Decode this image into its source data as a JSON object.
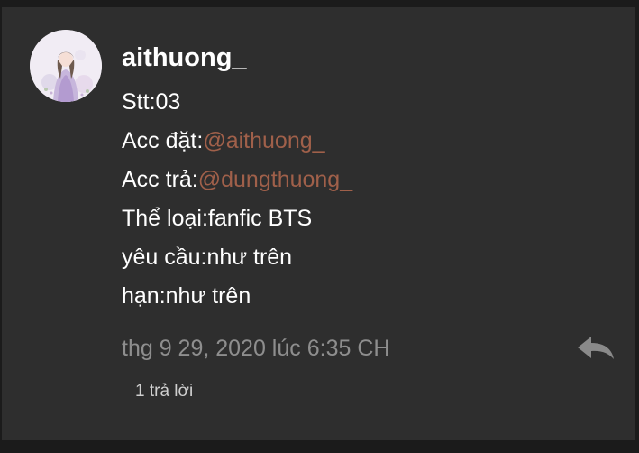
{
  "comment": {
    "username": "aithuong_",
    "lines": {
      "stt": "Stt:03",
      "acc_dat_label": "Acc đặt:",
      "acc_dat_mention": "@aithuong_",
      "acc_tra_label": "Acc trả:",
      "acc_tra_mention": "@dungthuong_",
      "the_loai": "Thể loại:fanfic BTS",
      "yeu_cau": "yêu cầu:như trên",
      "han": "hạn:như trên"
    },
    "timestamp": "thg 9 29, 2020 lúc 6:35 CH",
    "replies_label": "1 trả lời",
    "reply_icon": "reply-arrow-icon",
    "avatar_icon": "user-avatar"
  },
  "colors": {
    "background": "#1b1b1b",
    "card": "#2e2e2e",
    "text": "#ffffff",
    "mention": "#a0604a",
    "timestamp": "#8e8e8e",
    "reply_icon": "#8a8a8a"
  }
}
